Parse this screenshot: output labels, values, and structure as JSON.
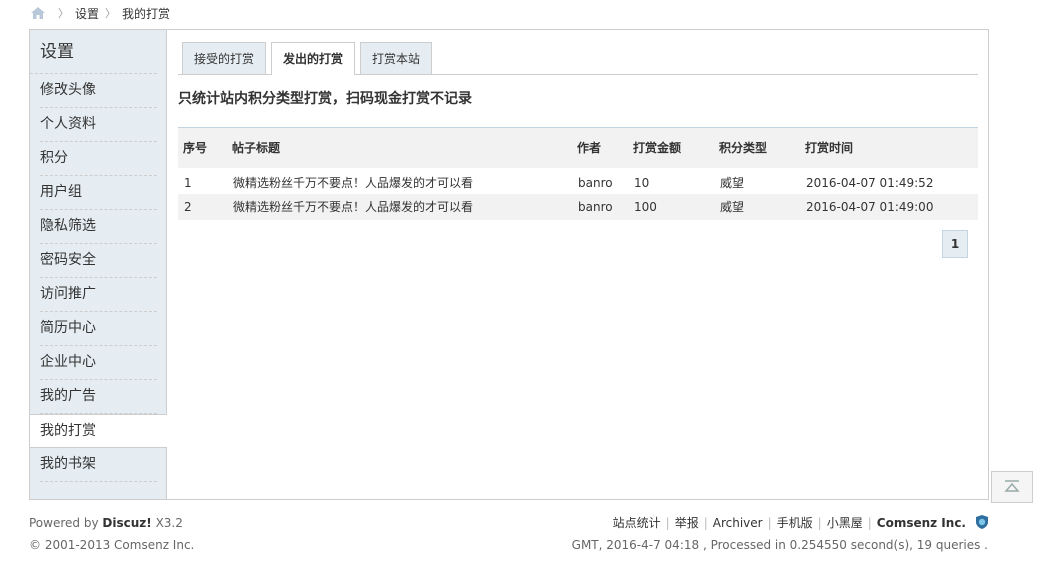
{
  "breadcrumb": {
    "items": [
      "设置",
      "我的打赏"
    ]
  },
  "sidebar": {
    "title": "设置",
    "items": [
      {
        "label": "修改头像"
      },
      {
        "label": "个人资料"
      },
      {
        "label": "积分"
      },
      {
        "label": "用户组"
      },
      {
        "label": "隐私筛选"
      },
      {
        "label": "密码安全"
      },
      {
        "label": "访问推广"
      },
      {
        "label": "简历中心"
      },
      {
        "label": "企业中心"
      },
      {
        "label": "我的广告"
      },
      {
        "label": "我的打赏",
        "active": true
      },
      {
        "label": "我的书架"
      }
    ]
  },
  "tabs": [
    {
      "label": "接受的打赏"
    },
    {
      "label": "发出的打赏",
      "active": true
    },
    {
      "label": "打赏本站"
    }
  ],
  "notice": "只统计站内积分类型打赏，扫码现金打赏不记录",
  "table": {
    "headers": [
      "序号",
      "帖子标题",
      "作者",
      "打赏金额",
      "积分类型",
      "打赏时间"
    ],
    "rows": [
      [
        "1",
        "微精选粉丝千万不要点！人品爆发的才可以看",
        "banro",
        "10",
        "威望",
        "2016-04-07 01:49:52"
      ],
      [
        "2",
        "微精选粉丝千万不要点！人品爆发的才可以看",
        "banro",
        "100",
        "威望",
        "2016-04-07 01:49:00"
      ]
    ]
  },
  "pagination": {
    "current": "1"
  },
  "footer": {
    "powered_prefix": "Powered by",
    "product": "Discuz!",
    "version": "X3.2",
    "copyright": "© 2001-2013 Comsenz Inc.",
    "links": [
      "站点统计",
      "举报",
      "Archiver",
      "手机版",
      "小黑屋"
    ],
    "company": "Comsenz Inc.",
    "status": "GMT, 2016-4-7 04:18 , Processed in 0.254550 second(s), 19 queries ."
  },
  "colors": {
    "sidebar_bg": "#e5edf2",
    "border": "#cdcdcd",
    "table_header_bg": "#f2f2f2"
  },
  "icons": [
    "home-icon",
    "shield-icon",
    "back-to-top-icon"
  ]
}
